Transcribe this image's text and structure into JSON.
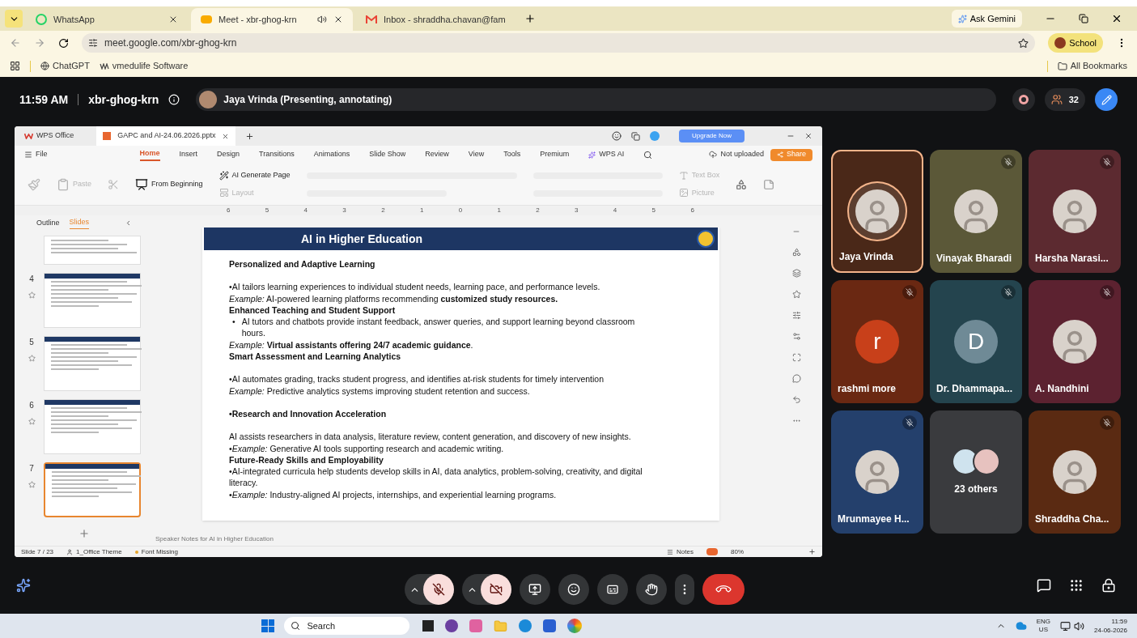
{
  "browser": {
    "tabs": [
      {
        "label": "WhatsApp",
        "kind": "whatsapp",
        "selected": false,
        "audio": false
      },
      {
        "label": "Meet - xbr-ghog-krn",
        "kind": "meet",
        "selected": true,
        "audio": true
      },
      {
        "label": "Inbox - shraddha.chavan@fam",
        "kind": "mail",
        "selected": false,
        "audio": false
      }
    ],
    "gemini": "Ask Gemini",
    "url": "meet.google.com/xbr-ghog-krn",
    "profile": "School",
    "bookmarks": [
      "ChatGPT",
      "vmedulife Software"
    ],
    "all_bookmarks": "All Bookmarks"
  },
  "meet": {
    "time": "11:59 AM",
    "code": "xbr-ghog-krn",
    "presenter": "Jaya Vrinda (Presenting, annotating)",
    "participants": "32",
    "controls": [
      {
        "kind": "mic",
        "off": true,
        "caret": true
      },
      {
        "kind": "camera",
        "off": true,
        "caret": true
      },
      {
        "kind": "present",
        "off": false,
        "caret": false
      },
      {
        "kind": "emoji",
        "off": false,
        "caret": false
      },
      {
        "kind": "captions",
        "off": false,
        "caret": false
      },
      {
        "kind": "hand",
        "off": false,
        "caret": false
      },
      {
        "kind": "more",
        "caret": false
      },
      {
        "kind": "hangup",
        "caret": false
      }
    ],
    "tiles": [
      {
        "name": "Jaya Vrinda",
        "color": "#4a2818",
        "muted": false,
        "speaking": true,
        "avatar": {
          "kind": "photo"
        }
      },
      {
        "name": "Vinayak Bharadi",
        "color": "#5b5838",
        "muted": true,
        "speaking": false,
        "avatar": {
          "kind": "photo"
        }
      },
      {
        "name": "Harsha Narasi...",
        "color": "#5c2a30",
        "muted": true,
        "speaking": false,
        "avatar": {
          "kind": "photo"
        }
      },
      {
        "name": "rashmi more",
        "color": "#6a2812",
        "muted": true,
        "speaking": false,
        "avatar": {
          "kind": "letter",
          "letter": "r",
          "color": "#c8401a"
        }
      },
      {
        "name": "Dr. Dhammapa...",
        "color": "#24444e",
        "muted": true,
        "speaking": false,
        "avatar": {
          "kind": "letter",
          "letter": "D",
          "color": "#6f8a96"
        }
      },
      {
        "name": "A. Nandhini",
        "color": "#5c2230",
        "muted": true,
        "speaking": false,
        "avatar": {
          "kind": "photo"
        }
      },
      {
        "name": "Mrunmayee H...",
        "color": "#24406c",
        "muted": true,
        "speaking": false,
        "avatar": {
          "kind": "photo"
        }
      },
      {
        "name": "23 others",
        "color": "#3a3b3e",
        "muted": false,
        "speaking": false,
        "avatar": {
          "kind": "group"
        }
      },
      {
        "name": "Shraddha Cha...",
        "color": "#5a2a12",
        "muted": true,
        "speaking": false,
        "avatar": {
          "kind": "photo"
        }
      }
    ]
  },
  "wps": {
    "app": "WPS Office",
    "file": "GAPC and AI-24.06.2026.pptx",
    "upgrade": "Upgrade Now",
    "file_menu": "File",
    "menu": [
      {
        "label": "Home",
        "selected": true
      },
      {
        "label": "Insert",
        "selected": false
      },
      {
        "label": "Design",
        "selected": false
      },
      {
        "label": "Transitions",
        "selected": false
      },
      {
        "label": "Animations",
        "selected": false
      },
      {
        "label": "Slide Show",
        "selected": false
      },
      {
        "label": "Review",
        "selected": false
      },
      {
        "label": "View",
        "selected": false
      },
      {
        "label": "Tools",
        "selected": false
      },
      {
        "label": "Premium",
        "selected": false
      }
    ],
    "wps_ai": "WPS AI",
    "not_uploaded": "Not uploaded",
    "share": "Share",
    "ribbon": [
      {
        "label": "Paste",
        "kind": "paste",
        "disabled": true
      },
      {
        "label": "From Beginning",
        "kind": "start",
        "disabled": false
      },
      {
        "label": "AI Generate Page",
        "kind": "ai",
        "disabled": false
      },
      {
        "label": "Layout",
        "kind": "layout",
        "disabled": true
      },
      {
        "label": "Text Box",
        "kind": "textbox",
        "disabled": true
      },
      {
        "label": "Picture",
        "kind": "picture",
        "disabled": true
      }
    ],
    "ruler": [
      "6",
      "5",
      "4",
      "3",
      "2",
      "1",
      "0",
      "1",
      "2",
      "3",
      "4",
      "5",
      "6"
    ],
    "panel_tabs": [
      {
        "label": "Outline",
        "selected": false
      },
      {
        "label": "Slides",
        "selected": true
      }
    ],
    "thumbnails": [
      {
        "number": "4",
        "selected": false
      },
      {
        "number": "5",
        "selected": false
      },
      {
        "number": "6",
        "selected": false
      },
      {
        "number": "7",
        "selected": true
      }
    ],
    "slide": {
      "title": "AI in Higher Education",
      "lines": [
        {
          "kind": "heading",
          "text": "Personalized and Adaptive Learning",
          "space_before": false
        },
        {
          "kind": "body",
          "text": "•AI tailors learning experiences to individual student needs, learning pace, and performance levels.",
          "space_before": true
        },
        {
          "kind": "body",
          "text": "*Example:* AI-powered learning platforms recommending **customized study resources.**",
          "space_before": false
        },
        {
          "kind": "heading",
          "text": "Enhanced Teaching and Student Support",
          "space_before": false
        },
        {
          "kind": "bullet",
          "marker": "•",
          "text": "AI tutors and chatbots provide instant feedback, answer queries, and support learning beyond classroom hours.",
          "space_before": false
        },
        {
          "kind": "body",
          "text": "*Example:* **Virtual assistants offering 24/7 academic guidance**.",
          "space_before": false
        },
        {
          "kind": "heading",
          "text": "Smart Assessment and Learning Analytics",
          "space_before": false
        },
        {
          "kind": "body",
          "text": "•AI automates grading, tracks student progress, and identifies at-risk students for timely intervention",
          "space_before": true
        },
        {
          "kind": "body",
          "text": "*Example:* Predictive analytics systems improving student retention and success.",
          "space_before": false
        },
        {
          "kind": "heading",
          "text": "•Research and Innovation Acceleration",
          "space_before": true
        },
        {
          "kind": "body",
          "text": "AI assists researchers in data analysis, literature review, content generation, and discovery of new insights.",
          "space_before": true
        },
        {
          "kind": "body",
          "text": "•*Example:* Generative AI tools supporting research and academic writing.",
          "space_before": false
        },
        {
          "kind": "heading",
          "text": "Future-Ready Skills and Employability",
          "space_before": false
        },
        {
          "kind": "body",
          "text": "•AI-integrated curricula help students develop skills in AI, data analytics, problem-solving, creativity, and digital literacy.",
          "space_before": false
        },
        {
          "kind": "body",
          "text": "•*Example:* Industry-aligned AI projects, internships, and experiential learning programs.",
          "space_before": false
        }
      ]
    },
    "notes": "Speaker Notes for AI in Higher Education",
    "status": {
      "slide": "Slide 7 / 23",
      "theme": "1_Office Theme",
      "font": "Font Missing",
      "notes": "Notes",
      "zoom": "80%"
    }
  },
  "taskbar": {
    "search": "Search",
    "lang": "ENG",
    "region": "US",
    "time": "11:59",
    "date": "24-06-2026"
  }
}
